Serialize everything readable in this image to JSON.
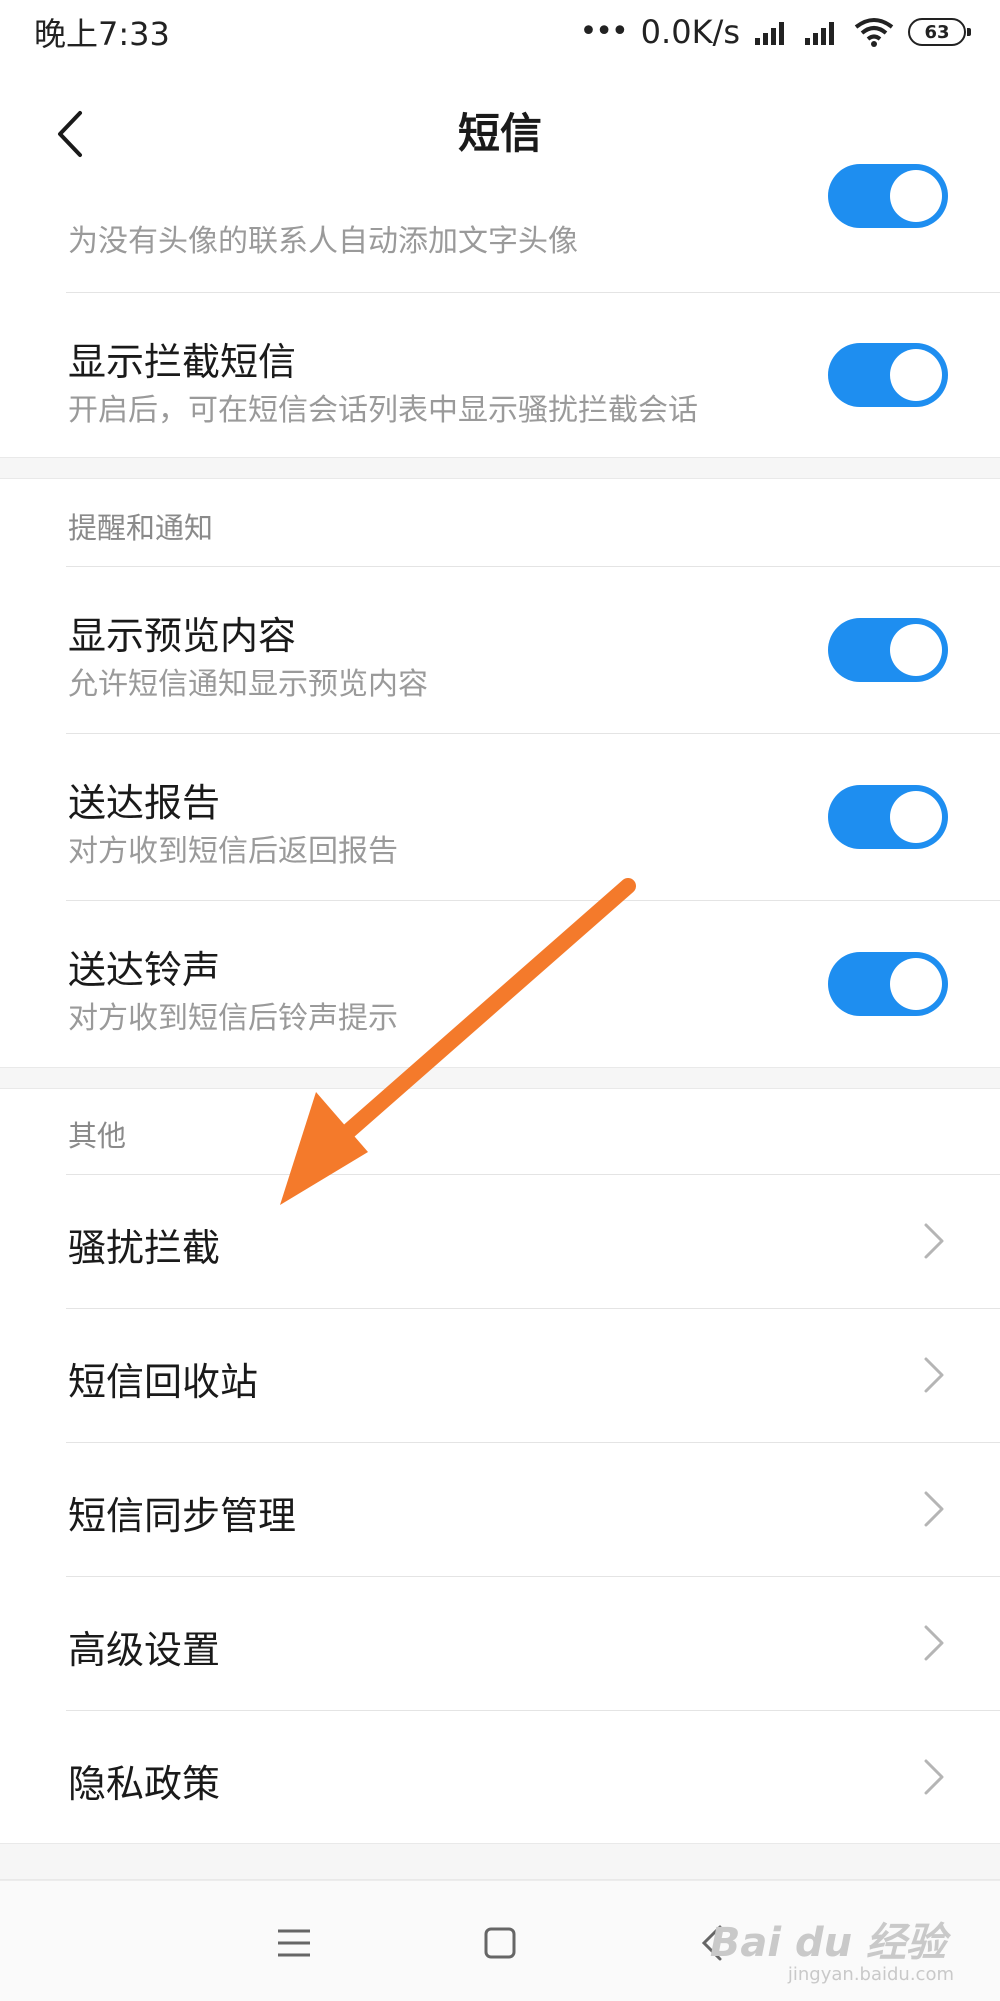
{
  "status": {
    "time": "晚上7:33",
    "network_speed": "0.0K/s",
    "battery": "63"
  },
  "header": {
    "title": "短信",
    "back_icon": "chevron-left-icon"
  },
  "settings": {
    "avatar": {
      "subtitle": "为没有头像的联系人自动添加文字头像",
      "enabled": true
    },
    "show_blocked": {
      "title": "显示拦截短信",
      "subtitle": "开启后，可在短信会话列表中显示骚扰拦截会话",
      "enabled": true
    },
    "section_notify": "提醒和通知",
    "show_preview": {
      "title": "显示预览内容",
      "subtitle": "允许短信通知显示预览内容",
      "enabled": true
    },
    "delivery_report": {
      "title": "送达报告",
      "subtitle": "对方收到短信后返回报告",
      "enabled": true
    },
    "delivery_ringtone": {
      "title": "送达铃声",
      "subtitle": "对方收到短信后铃声提示",
      "enabled": true
    },
    "section_other": "其他",
    "other_items": [
      "骚扰拦截",
      "短信回收站",
      "短信同步管理",
      "高级设置",
      "隐私政策"
    ]
  },
  "annotation": {
    "color": "#f47a2b"
  },
  "watermark": {
    "text": "Bai du 经验",
    "url": "jingyan.baidu.com"
  },
  "colors": {
    "accent": "#1e8ef0"
  }
}
